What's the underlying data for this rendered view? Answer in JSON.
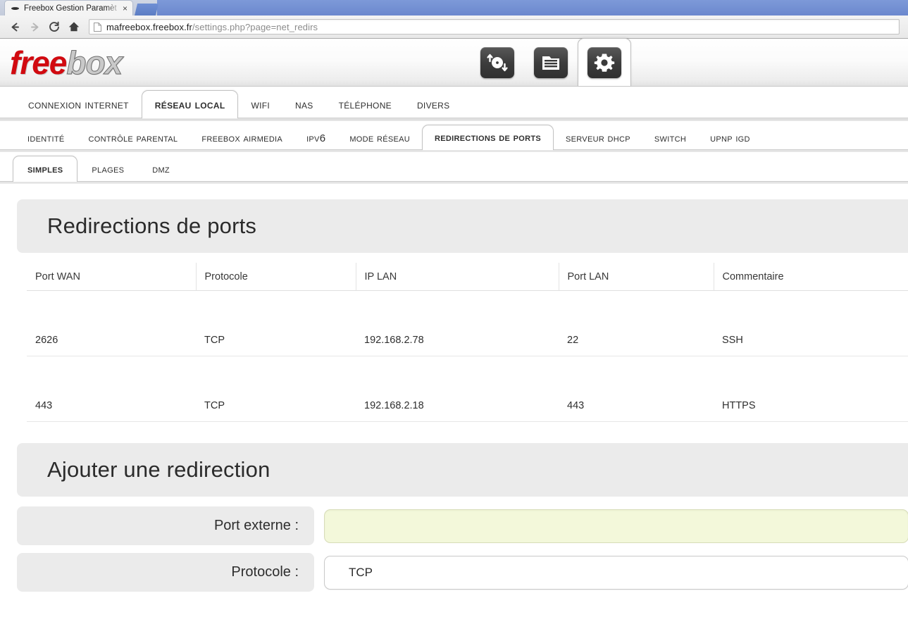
{
  "browser": {
    "tab_title": "Freebox Gestion Paramèt",
    "tab_close_label": "×",
    "back_label": "←",
    "forward_label": "→",
    "reload_label": "⟳",
    "home_label": "⌂",
    "url_main": "mafreebox.freebox.fr",
    "url_path": "/settings.php?page=net_redirs"
  },
  "header": {
    "logo_free": "free",
    "logo_box": "box",
    "icons": [
      {
        "name": "transfers-icon",
        "active": false
      },
      {
        "name": "files-icon",
        "active": false
      },
      {
        "name": "settings-gear-icon",
        "active": true
      }
    ]
  },
  "nav_level1": [
    {
      "label": "Connexion Internet",
      "active": false
    },
    {
      "label": "Réseau local",
      "active": true
    },
    {
      "label": "Wifi",
      "active": false
    },
    {
      "label": "NAS",
      "active": false
    },
    {
      "label": "Téléphone",
      "active": false
    },
    {
      "label": "Divers",
      "active": false
    }
  ],
  "nav_level2": [
    {
      "label": "Identité",
      "active": false
    },
    {
      "label": "Contrôle parental",
      "active": false
    },
    {
      "label": "Freebox AirMedia",
      "active": false
    },
    {
      "label": "IPv6",
      "active": false
    },
    {
      "label": "Mode Réseau",
      "active": false
    },
    {
      "label": "Redirections de ports",
      "active": true
    },
    {
      "label": "Serveur DHCP",
      "active": false
    },
    {
      "label": "Switch",
      "active": false
    },
    {
      "label": "UPnP IGD",
      "active": false
    }
  ],
  "nav_level3": [
    {
      "label": "Simples",
      "active": true
    },
    {
      "label": "Plages",
      "active": false
    },
    {
      "label": "DMZ",
      "active": false
    }
  ],
  "redirections_section": {
    "title": "Redirections de ports",
    "columns": [
      "Port WAN",
      "Protocole",
      "IP LAN",
      "Port LAN",
      "Commentaire"
    ],
    "rows": [
      {
        "port_wan": "2626",
        "protocole": "TCP",
        "ip_lan": "192.168.2.78",
        "port_lan": "22",
        "commentaire": "SSH"
      },
      {
        "port_wan": "443",
        "protocole": "TCP",
        "ip_lan": "192.168.2.18",
        "port_lan": "443",
        "commentaire": "HTTPS"
      }
    ]
  },
  "add_section": {
    "title": "Ajouter une redirection",
    "fields": [
      {
        "label": "Port externe :",
        "value": "",
        "placeholder": "",
        "kind": "input"
      },
      {
        "label": "Protocole :",
        "value": "TCP",
        "kind": "select"
      }
    ]
  },
  "colors": {
    "logo_red": "#d10a10",
    "panel_gray": "#ebebeb",
    "input_yellow": "#f3f8da",
    "tabstrip_blue": "#6b88ce"
  }
}
